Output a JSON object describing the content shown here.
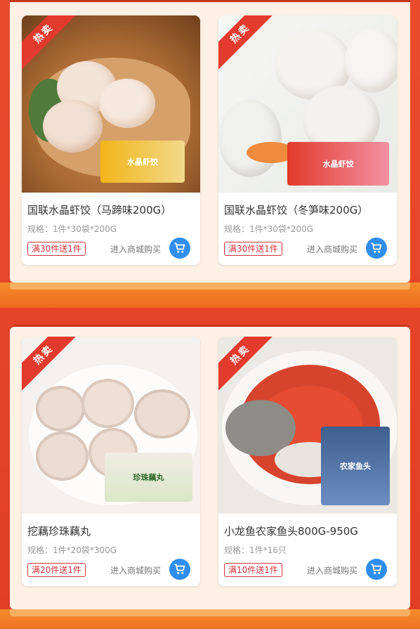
{
  "products": [
    {
      "ribbon": "热卖",
      "title": "国联水晶虾饺（马蹄味200G）",
      "spec": "规格：1件*30袋*200G",
      "badge": "满30件送1件",
      "buy_label": "进入商城购买",
      "package_text": "水晶虾饺"
    },
    {
      "ribbon": "热卖",
      "title": "国联水晶虾饺（冬笋味200G）",
      "spec": "规格：1件*30袋*200G",
      "badge": "满30件送1件",
      "buy_label": "进入商城购买",
      "package_text": "水晶虾饺"
    },
    {
      "ribbon": "热卖",
      "title": "挖藕珍珠藕丸",
      "spec": "规格：1件*20袋*300G",
      "badge": "满20件送1件",
      "buy_label": "进入商城购买",
      "package_text": "珍珠藕丸"
    },
    {
      "ribbon": "热卖",
      "title": "小龙鱼农家鱼头800G-950G",
      "spec": "规格：1件*16只",
      "badge": "满10件送1件",
      "buy_label": "进入商城购买",
      "package_text": "农家鱼头"
    }
  ],
  "colors": {
    "background": "#e8452a",
    "panel": "#fdf1e6",
    "ribbon": "#e23a2c",
    "badge": "#d6333d",
    "cart": "#2f8ef0",
    "band": "#f07a24"
  }
}
